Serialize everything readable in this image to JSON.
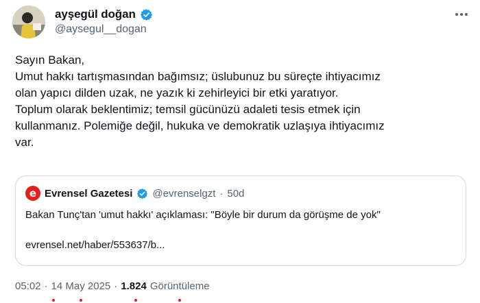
{
  "author": {
    "display_name": "ayşegül doğan",
    "handle": "@aysegul__dogan",
    "verified": true
  },
  "more_icon": "more-horizontal-icon",
  "body_lines": [
    "Sayın Bakan,",
    "Umut hakkı tartışmasından bağımsız; üslubunuz bu süreçte ihtiyacımız",
    "olan yapıcı dilden uzak, ne yazık ki zehirleyici bir etki yaratıyor.",
    "Toplum olarak beklentimiz; temsil gücünüzü adaleti tesis etmek için",
    "kullanmanız. Polemiğe değil, hukuka ve demokratik uzlaşıya ihtiyacımız",
    "var."
  ],
  "quoted": {
    "logo_letter": "e",
    "display_name": "Evrensel Gazetesi",
    "verified": true,
    "handle": "@evrenselgzt",
    "separator": "·",
    "time": "50d",
    "text": "Bakan Tunç'tan 'umut hakkı' açıklaması: \"Böyle bir durum da görüşme de yok\"",
    "link": "evrensel.net/haber/553637/b..."
  },
  "meta": {
    "time": "05:02",
    "separator1": "·",
    "date": "14 May 2025",
    "separator2": "·",
    "views": "1.824",
    "views_label": "Görüntüleme"
  },
  "colors": {
    "verified_blue": "#1d9bf0",
    "brand_red": "#e0211b",
    "text_primary": "#0f1419",
    "text_secondary": "#536471",
    "border": "#cfd9de"
  }
}
